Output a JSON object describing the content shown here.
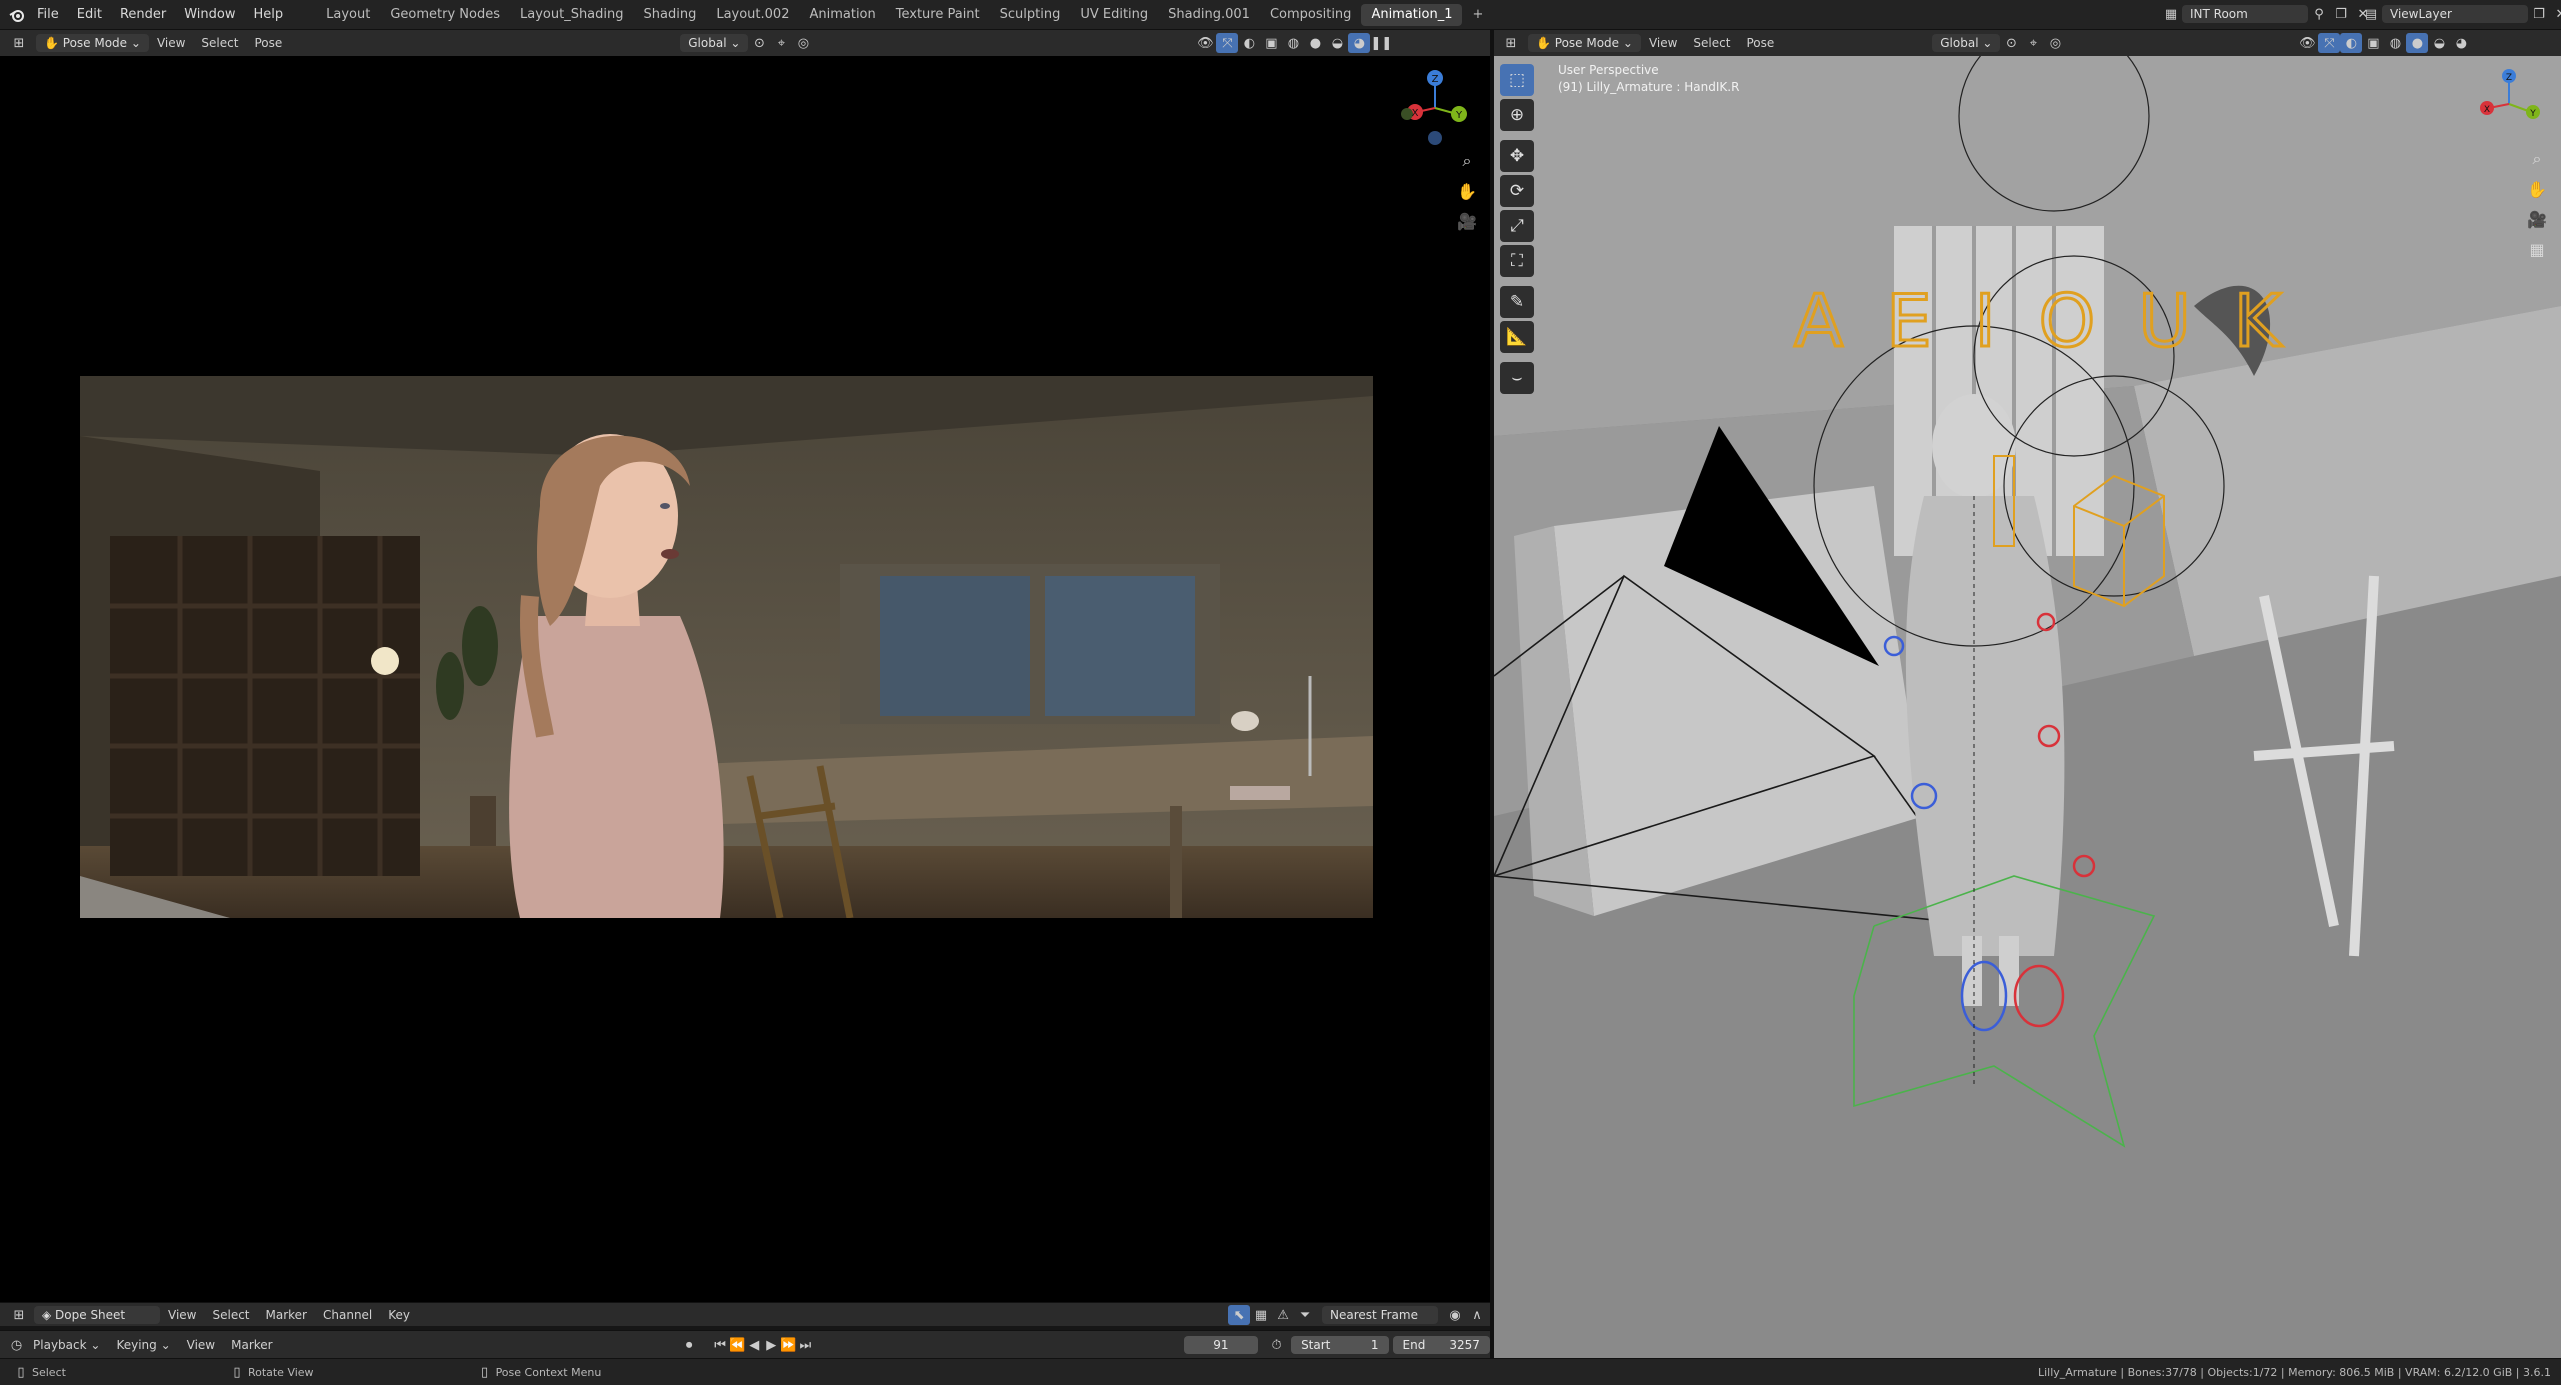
{
  "app": {
    "menus": [
      "File",
      "Edit",
      "Render",
      "Window",
      "Help"
    ],
    "workspaces": [
      "Layout",
      "Geometry Nodes",
      "Layout_Shading",
      "Shading",
      "Layout.002",
      "Animation",
      "Texture Paint",
      "Sculpting",
      "UV Editing",
      "Shading.001",
      "Compositing",
      "Animation_1"
    ],
    "active_workspace": "Animation_1",
    "add_tab": "+",
    "scene": "INT Room",
    "view_layer": "ViewLayer"
  },
  "left_view": {
    "mode": "Pose Mode",
    "menus": [
      "View",
      "Select",
      "Pose"
    ],
    "orientation": "Global",
    "gizmo_axes": {
      "z": "Z",
      "y": "Y",
      "x": "X"
    }
  },
  "right_view": {
    "mode": "Pose Mode",
    "menus": [
      "View",
      "Select",
      "Pose"
    ],
    "orientation": "Global",
    "perspective": "User Perspective",
    "object_info": "(91) Lilly_Armature : HandIK.R",
    "text_object": "A E I O U K",
    "gizmo_axes": {
      "z": "Z",
      "y": "Y",
      "x": "X"
    }
  },
  "dopesheet": {
    "editor": "Dope Sheet",
    "menus": [
      "View",
      "Select",
      "Marker",
      "Channel",
      "Key"
    ],
    "snapping": "Nearest Frame"
  },
  "timeline": {
    "menus": [
      "Playback",
      "Keying",
      "View",
      "Marker"
    ],
    "current_frame": "91",
    "start_label": "Start",
    "start": "1",
    "end_label": "End",
    "end": "3257"
  },
  "statusbar": {
    "select": "Select",
    "rotate": "Rotate View",
    "context": "Pose Context Menu",
    "stats": "Lilly_Armature | Bones:37/78 | Objects:1/72 | Memory: 806.5 MiB | VRAM: 6.2/12.0 GiB | 3.6.1"
  },
  "colors": {
    "accent": "#4772b3",
    "header": "#2b2b2b",
    "topbar": "#232323",
    "viewport_gray": "#8f8f8f"
  }
}
